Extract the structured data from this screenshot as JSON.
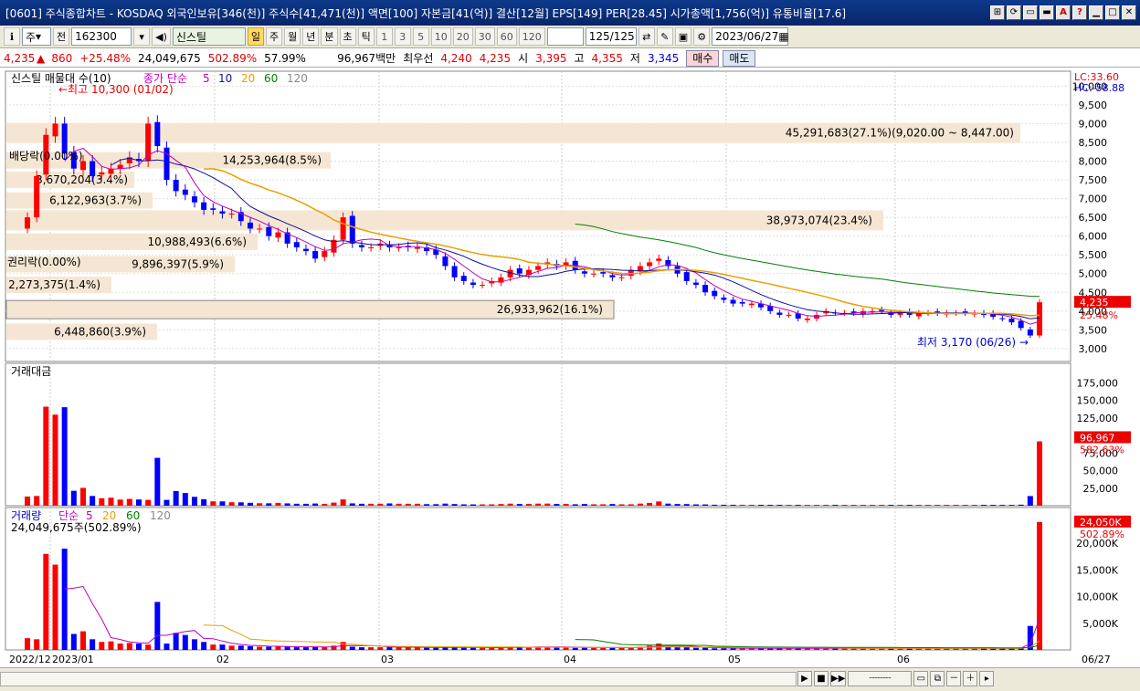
{
  "window": {
    "title": "[0601] 주식종합차트 - KOSDAQ 외국인보유[346(천)] 주식수[41,471(천)] 액면[100] 자본금[41(억)] 결산[12월] EPS[149] PER[28.45] 시가총액[1,756(억)] 유통비율[17.6]",
    "buttons": [
      "⊞",
      "⟳",
      "▭",
      "▬",
      "A",
      "?",
      "▁",
      "□",
      "✕"
    ]
  },
  "toolbar": {
    "type_select": "주",
    "type_label": "전",
    "code": "162300",
    "name": "신스틸",
    "period_active": "일",
    "periods": [
      "주",
      "월",
      "년",
      "분",
      "초",
      "틱"
    ],
    "intervals": [
      "1",
      "3",
      "5",
      "10",
      "20",
      "30",
      "60",
      "120"
    ],
    "count": "125",
    "count_total": "/125",
    "date": "2023/06/27"
  },
  "quote": {
    "price": "4,235",
    "arrow": "▲",
    "change": "860",
    "change_pct": "+25.48%",
    "volume": "24,049,675",
    "vol_ratio": "502.89%",
    "turnover": "57.99%",
    "amount": "96,967백만",
    "bid_label": "최우선",
    "ask": "4,240",
    "bid": "4,235",
    "open_label": "시",
    "open": "3,395",
    "high_label": "고",
    "high": "4,355",
    "low_label": "저",
    "low": "3,345",
    "buy": "매수",
    "sell": "매도"
  },
  "price_panel": {
    "header": "신스틸 매물대 수(10)",
    "ma_label": "종가 단순",
    "ma_periods": [
      "5",
      "10",
      "20",
      "60",
      "120"
    ],
    "lc": "LC:33.60",
    "hc": "HC:-58.88",
    "max_label": "최고 10,300 (01/02)",
    "min_label": "최저 3,170 (06/26)",
    "last_price": "4,235",
    "last_pct": "25.48%",
    "div_label": "배당락(0.00%)",
    "rights_label": "권리락(0.00%)",
    "y_ticks": [
      "10,000",
      "9,500",
      "9,000",
      "8,500",
      "8,000",
      "7,500",
      "7,000",
      "6,500",
      "6,000",
      "5,500",
      "5,000",
      "4,500",
      "4,000",
      "3,500",
      "3,000"
    ],
    "profile": [
      {
        "label": "45,291,683(27.1%)(9,020.00 ~ 8,447.00)"
      },
      {
        "label": "14,253,964(8.5%)"
      },
      {
        "label": "3,670,204(3.4%)"
      },
      {
        "label": "6,122,963(3.7%)"
      },
      {
        "label": "38,973,074(23.4%)"
      },
      {
        "label": "10,988,493(6.6%)"
      },
      {
        "label": "9,896,397(5.9%)"
      },
      {
        "label": "2,273,375(1.4%)"
      },
      {
        "label": "26,933,962(16.1%)"
      },
      {
        "label": "6,448,860(3.9%)"
      }
    ]
  },
  "amount_panel": {
    "header": "거래대금",
    "y_ticks": [
      "175,000",
      "150,000",
      "125,000",
      "100,000",
      "75,000",
      "50,000",
      "25,000"
    ],
    "last": "96,967",
    "last_pct": "582.63%"
  },
  "volume_panel": {
    "header": "거래량",
    "ma_label": "단순",
    "ma_periods": [
      "5",
      "20",
      "60",
      "120"
    ],
    "value_label": "24,049,675주(502.89%)",
    "y_ticks": [
      "20,000K",
      "15,000K",
      "10,000K",
      "5,000K"
    ],
    "last": "24,050K",
    "last_pct": "502.89%"
  },
  "x_axis": {
    "labels": [
      "2022/12",
      "2023/01",
      "02",
      "03",
      "04",
      "05",
      "06"
    ],
    "end_label": "06/27"
  },
  "chart_data": {
    "type": "candlestick",
    "ylim": [
      2900,
      10300
    ],
    "closes": [
      6500,
      7600,
      8700,
      9000,
      8200,
      7800,
      8000,
      7600,
      7700,
      7800,
      7900,
      8100,
      8000,
      9000,
      8400,
      7500,
      7200,
      7100,
      6900,
      6700,
      6700,
      6600,
      6600,
      6400,
      6200,
      6200,
      6000,
      6100,
      5800,
      5700,
      5600,
      5400,
      5600,
      5900,
      6500,
      5800,
      5700,
      5700,
      5800,
      5700,
      5700,
      5700,
      5700,
      5600,
      5500,
      5200,
      4900,
      4800,
      4700,
      4700,
      4800,
      4900,
      5100,
      5000,
      5100,
      5200,
      5300,
      5200,
      5300,
      5100,
      5000,
      5000,
      5000,
      4900,
      4900,
      5100,
      5200,
      5300,
      5400,
      5200,
      5000,
      4800,
      4700,
      4500,
      4400,
      4300,
      4200,
      4200,
      4200,
      4100,
      4000,
      3900,
      3900,
      3800,
      3800,
      3900,
      4000,
      3950,
      3950,
      3950,
      4000,
      4000,
      4000,
      3900,
      3950,
      3900,
      3950,
      3950,
      3950,
      3950,
      3950,
      3950,
      3950,
      3900,
      3850,
      3800,
      3700,
      3550,
      3350,
      4235
    ],
    "volume": [
      2.2,
      2.0,
      18,
      16,
      19,
      3,
      3.5,
      2,
      1.5,
      1.6,
      1.2,
      1.3,
      1.2,
      1.0,
      9,
      1.2,
      3.2,
      2.8,
      2.0,
      1.5,
      1.0,
      1.0,
      0.8,
      0.8,
      0.7,
      0.6,
      0.6,
      0.7,
      0.6,
      0.5,
      0.5,
      0.6,
      0.5,
      0.8,
      1.5,
      0.6,
      0.5,
      0.5,
      0.5,
      0.6,
      0.5,
      0.5,
      0.5,
      0.4,
      0.4,
      0.6,
      0.5,
      0.4,
      0.4,
      0.4,
      0.4,
      0.5,
      0.6,
      0.5,
      0.5,
      0.6,
      0.6,
      0.5,
      0.5,
      0.4,
      0.5,
      0.4,
      0.4,
      0.5,
      0.4,
      0.4,
      0.6,
      0.8,
      1.2,
      0.6,
      0.5,
      0.5,
      0.4,
      0.4,
      0.3,
      0.3,
      0.3,
      0.3,
      0.3,
      0.3,
      0.3,
      0.3,
      0.3,
      0.3,
      0.3,
      0.3,
      0.3,
      0.3,
      0.3,
      0.3,
      0.3,
      0.3,
      0.3,
      0.3,
      0.3,
      0.3,
      0.3,
      0.3,
      0.3,
      0.3,
      0.3,
      0.3,
      0.3,
      0.3,
      0.3,
      0.3,
      0.3,
      0.4,
      4.5,
      24
    ]
  },
  "colors": {
    "up": "#ff0000",
    "down": "#0000ff",
    "ma5": "#c000c0",
    "ma10": "#1010a0",
    "ma20": "#e8a000",
    "ma60": "#008000",
    "profile": "#f5e6d3",
    "title": "#0a246a"
  }
}
